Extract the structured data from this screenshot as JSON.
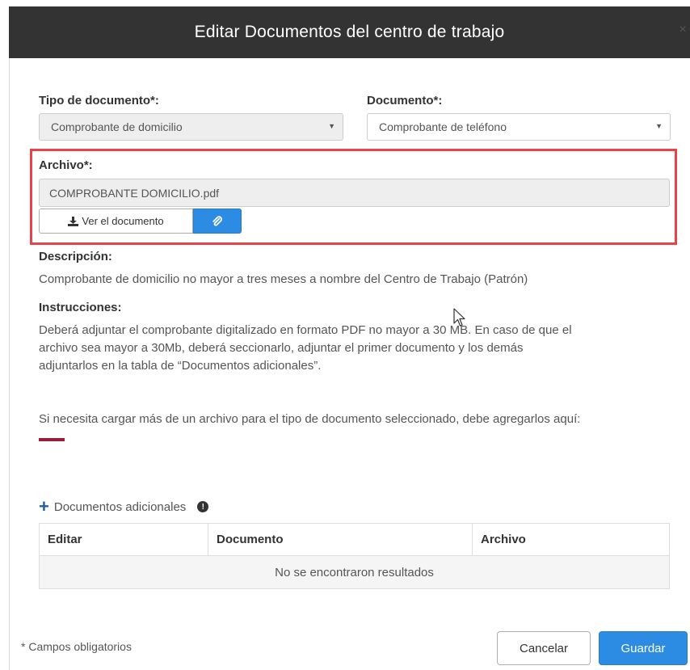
{
  "modal": {
    "title": "Editar Documentos del centro de trabajo",
    "close_glyph": "×"
  },
  "form": {
    "tipo_label": "Tipo de documento*:",
    "tipo_value": "Comprobante de domicilio",
    "documento_label": "Documento*:",
    "documento_value": "Comprobante de teléfono",
    "archivo_label": "Archivo*:",
    "archivo_value": "COMPROBANTE DOMICILIO.pdf",
    "ver_button": "Ver el documento"
  },
  "descripcion": {
    "label": "Descripción:",
    "text": "Comprobante de domicilio no mayor a tres meses a nombre del Centro de Trabajo (Patrón)"
  },
  "instrucciones": {
    "label": "Instrucciones:",
    "line1": "Deberá adjuntar el comprobante digitalizado en formato PDF no mayor a 30 MB. En caso de que el",
    "line2": "archivo sea mayor a 30Mb, deberá seccionarlo, adjuntar el primer documento y los demás",
    "line3": "adjuntarlos en la tabla de “Documentos adicionales”."
  },
  "extra_note": "Si necesita cargar más de un archivo para el tipo de documento seleccionado, debe agregarlos aquí:",
  "additional": {
    "label": "Documentos adicionales",
    "columns": [
      "Editar",
      "Documento",
      "Archivo"
    ],
    "empty_message": "No se encontraron resultados"
  },
  "footer": {
    "required_note": "* Campos obligatorios",
    "cancel": "Cancelar",
    "save": "Guardar"
  },
  "colors": {
    "header_bg": "#333333",
    "primary": "#2c8be3",
    "highlight": "#e8434a",
    "accent": "#9b1b3e"
  },
  "icons": [
    "download-icon",
    "paperclip-icon",
    "plus-icon",
    "info-icon",
    "caret-down-icon",
    "cursor-icon"
  ]
}
